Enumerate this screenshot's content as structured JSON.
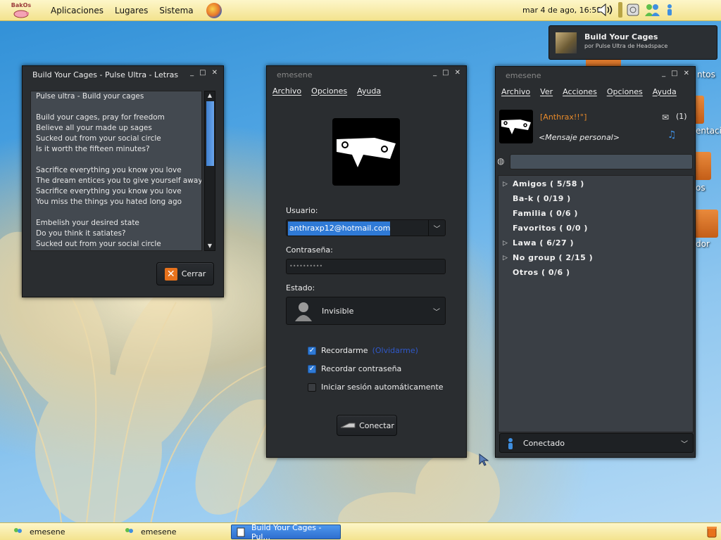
{
  "top_panel": {
    "logo_text": "BakOs",
    "menus": [
      "Aplicaciones",
      "Lugares",
      "Sistema"
    ],
    "clock": "mar  4 de ago, 16:59"
  },
  "notification": {
    "title": "Build Your Cages",
    "subtitle": "por Pulse Ultra de Headspace"
  },
  "desktop": {
    "labels": [
      "ntos",
      "entacion",
      "os",
      "dor"
    ]
  },
  "lyrics_window": {
    "title": "Build Your Cages - Pulse Ultra - Letras",
    "lines": [
      "Pulse ultra - Build your cages",
      "",
      "Build your cages, pray for freedom",
      "Believe all your made up sages",
      "Sucked out from your social circle",
      "Is it worth the fifteen minutes?",
      "",
      "Sacrifice everything you know you love",
      "The dream entices you to give yourself away",
      "Sacrifice everything you know you love",
      "You miss the things you hated long ago",
      "",
      "Embelish your desired state",
      "Do you think it satiates?",
      "Sucked out from your social circle"
    ],
    "close_label": "Cerrar"
  },
  "login_window": {
    "title": "emesene",
    "menus": [
      "Archivo",
      "Opciones",
      "Ayuda"
    ],
    "user_label": "Usuario:",
    "user_value": "anthraxp12@hotmail.com",
    "password_label": "Contraseña:",
    "password_value": "••••••••••",
    "status_label": "Estado:",
    "status_value": "Invisible",
    "remember_me": "Recordarme",
    "forget_me": "(Olvidarme)",
    "remember_password": "Recordar contraseña",
    "auto_login": "Iniciar sesión automáticamente",
    "connect_label": "Conectar"
  },
  "contacts_window": {
    "title": "emesene",
    "menus": [
      "Archivo",
      "Ver",
      "Acciones",
      "Opciones",
      "Ayuda"
    ],
    "nick": "[Anthrax!!°]",
    "personal_message": "<Mensaje personal>",
    "mail_count": "(1)",
    "search_value": "",
    "groups": [
      {
        "label": "Amigos ( 5/58 )",
        "expandable": true
      },
      {
        "label": "Ba-k ( 0/19 )",
        "expandable": false
      },
      {
        "label": "Familia ( 0/6 )",
        "expandable": false
      },
      {
        "label": "Favoritos ( 0/0 )",
        "expandable": false
      },
      {
        "label": "Lawa ( 6/27 )",
        "expandable": true
      },
      {
        "label": "No group ( 2/15 )",
        "expandable": true
      },
      {
        "label": "Otros ( 0/6 )",
        "expandable": false
      }
    ],
    "status_value": "Conectado"
  },
  "taskbar": {
    "tasks": [
      {
        "label": "emesene",
        "active": false
      },
      {
        "label": "emesene",
        "active": false
      },
      {
        "label": "Build Your Cages - Pul...",
        "active": true
      }
    ]
  }
}
